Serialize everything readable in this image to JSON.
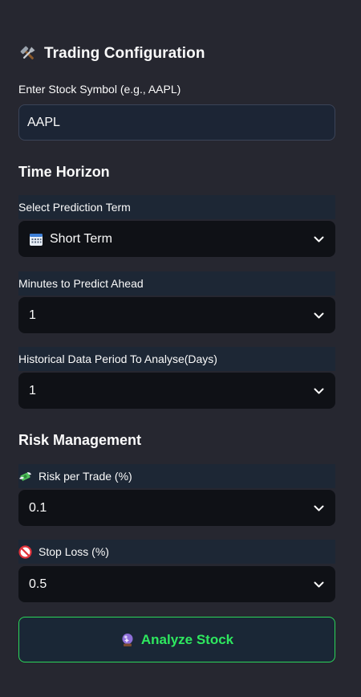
{
  "header": {
    "title": "Trading Configuration",
    "icon": "tools-icon"
  },
  "symbol": {
    "label": "Enter Stock Symbol (e.g., AAPL)",
    "value": "AAPL"
  },
  "time_horizon": {
    "heading": "Time Horizon",
    "prediction_term": {
      "label": "Select Prediction Term",
      "value": "Short Term",
      "icon": "calendar-icon"
    },
    "minutes_ahead": {
      "label": "Minutes to Predict Ahead",
      "value": "1"
    },
    "history_period": {
      "label": "Historical Data Period To Analyse(Days)",
      "value": "1"
    }
  },
  "risk": {
    "heading": "Risk Management",
    "risk_per_trade": {
      "label": "Risk per Trade (%)",
      "value": "0.1",
      "icon": "money-wings-icon"
    },
    "stop_loss": {
      "label": "Stop Loss (%)",
      "value": "0.5",
      "icon": "no-entry-icon"
    }
  },
  "action": {
    "label": "Analyze Stock",
    "icon": "crystal-ball-icon",
    "color": "#2ee85f"
  },
  "colors": {
    "background": "#262730",
    "input": "#1c2535",
    "select": "#0f1116",
    "accent": "#2bd65a"
  }
}
